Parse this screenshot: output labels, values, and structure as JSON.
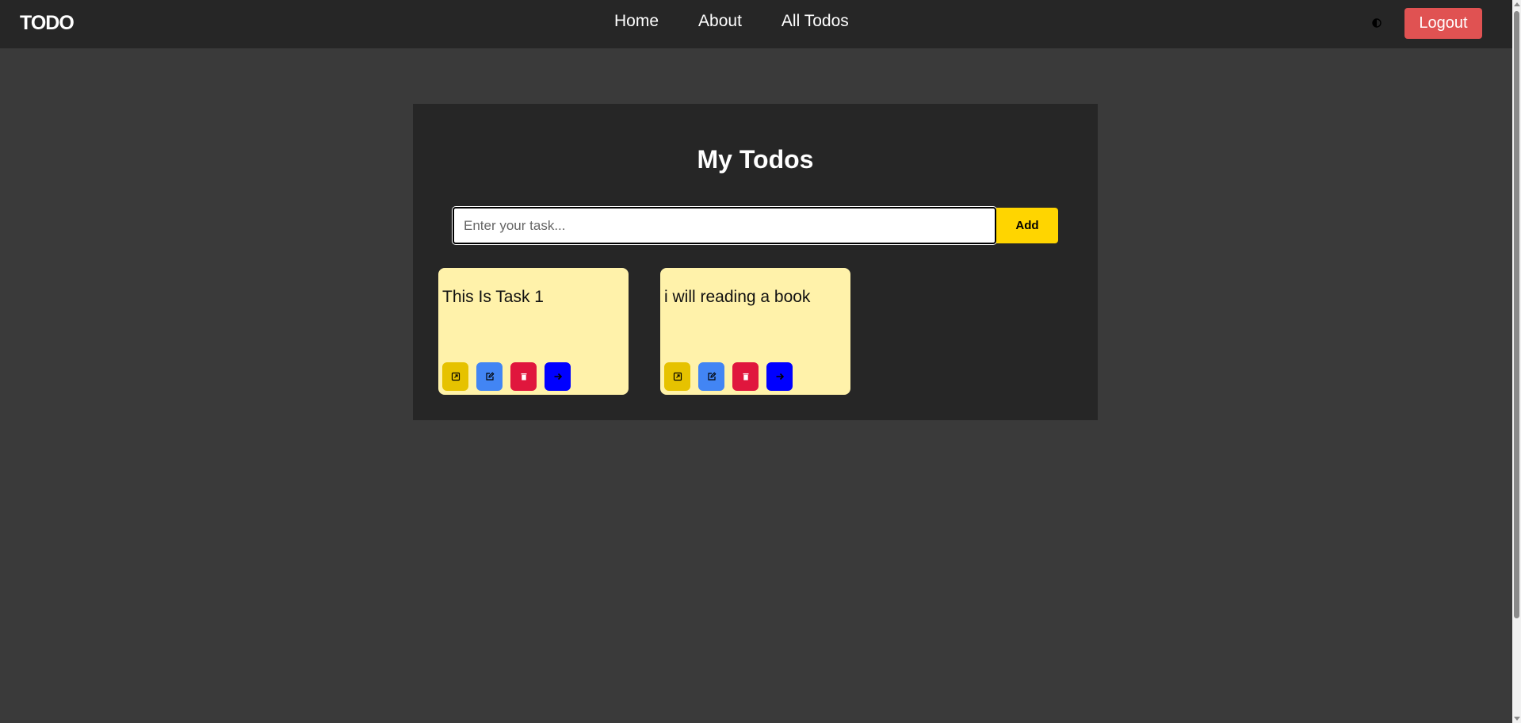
{
  "header": {
    "brand": "TODO",
    "nav": [
      {
        "label": "Home"
      },
      {
        "label": "About"
      },
      {
        "label": "All Todos"
      }
    ],
    "theme_toggle_icon": "half-circle-icon",
    "logout_label": "Logout"
  },
  "main": {
    "title": "My Todos",
    "input": {
      "placeholder": "Enter your task...",
      "value": ""
    },
    "add_label": "Add",
    "todos": [
      {
        "text": "This Is Task 1"
      },
      {
        "text": "i will reading a book"
      }
    ],
    "actions": [
      {
        "icon": "external-link-icon",
        "color": "#e6c200"
      },
      {
        "icon": "edit-icon",
        "color": "#4285f4"
      },
      {
        "icon": "trash-icon",
        "color": "#e0163d"
      },
      {
        "icon": "arrow-right-icon",
        "color": "#0000ff"
      }
    ]
  },
  "colors": {
    "background": "#3a3a3a",
    "navbar": "#262626",
    "panel": "#262626",
    "accent": "#ffd500",
    "logout": "#e05252",
    "card": "#fff2aa"
  }
}
